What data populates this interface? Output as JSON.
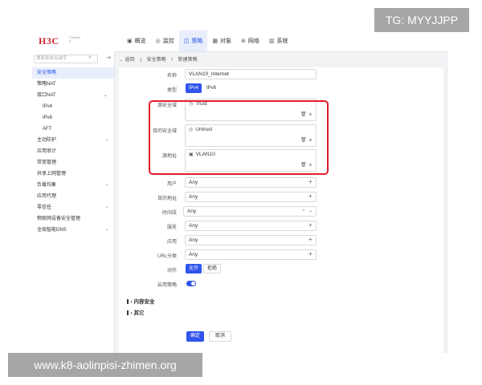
{
  "brand": {
    "logo": "H3C",
    "subtitle_line1": "Chassis",
    "subtitle_line2": "0"
  },
  "top_nav": [
    {
      "icon": "overview-icon",
      "glyph": "▣",
      "label": "概览"
    },
    {
      "icon": "monitor-icon",
      "glyph": "◎",
      "label": "监控"
    },
    {
      "icon": "policy-icon",
      "glyph": "◫",
      "label": "策略"
    },
    {
      "icon": "object-icon",
      "glyph": "▦",
      "label": "对象"
    },
    {
      "icon": "network-icon",
      "glyph": "⊛",
      "label": "网络"
    },
    {
      "icon": "system-icon",
      "glyph": "▥",
      "label": "系统"
    }
  ],
  "sidebar": {
    "search_placeholder": "搜索菜单关键字",
    "items": [
      {
        "label": "安全策略",
        "active": true
      },
      {
        "label": "策略NAT"
      },
      {
        "label": "接口NAT",
        "expand": "⌄"
      },
      {
        "label": "IPv4",
        "sub": true
      },
      {
        "label": "IPv6",
        "sub": true
      },
      {
        "label": "AFT",
        "sub": true
      },
      {
        "label": "主动防护",
        "expand": "›"
      },
      {
        "label": "应用审计"
      },
      {
        "label": "带宽管理"
      },
      {
        "label": "共享上网管理"
      },
      {
        "label": "负载均衡",
        "expand": "›"
      },
      {
        "label": "应用代理"
      },
      {
        "label": "零信任",
        "expand": "›"
      },
      {
        "label": "物联网设备安全管理"
      },
      {
        "label": "全局智能DNS",
        "expand": "›"
      }
    ]
  },
  "breadcrumb": {
    "back": "← 返回",
    "sep": "|",
    "level1": "安全策略",
    "slash": "/",
    "level2": "新建策略"
  },
  "form": {
    "name": {
      "label": "名称",
      "value": "VLAN10_Internet"
    },
    "type": {
      "label": "类型",
      "options": [
        "IPv4",
        "IPv6"
      ],
      "selected": "IPv4"
    },
    "src_zone": {
      "label": "源安全域",
      "value": "Trust"
    },
    "dst_zone": {
      "label": "目的安全域",
      "value": "Untrust"
    },
    "src_addr": {
      "label": "源地址",
      "value": "VLAN10"
    },
    "user": {
      "label": "用户",
      "value": "Any"
    },
    "dst_addr": {
      "label": "目的地址",
      "value": "Any"
    },
    "time_range": {
      "label": "时间段",
      "value": "Any"
    },
    "service": {
      "label": "服务",
      "value": "Any"
    },
    "application": {
      "label": "应用",
      "value": "Any"
    },
    "url_category": {
      "label": "URL分类",
      "value": "Any"
    },
    "action": {
      "label": "动作",
      "options": [
        "允许",
        "拒绝"
      ],
      "selected": "允许"
    },
    "enable": {
      "label": "启用策略",
      "on": true
    }
  },
  "sections": {
    "content_security": "› 内容安全",
    "other": "› 其它"
  },
  "buttons": {
    "ok": "确定",
    "cancel": "取消"
  },
  "watermarks": {
    "top": "TG: MYYJJPP",
    "bottom": "www.k8-aolinpisi-zhimen.org"
  },
  "colors": {
    "accent": "#2f54eb",
    "highlight_box": "#e01e2a",
    "brand": "#c9262e"
  }
}
